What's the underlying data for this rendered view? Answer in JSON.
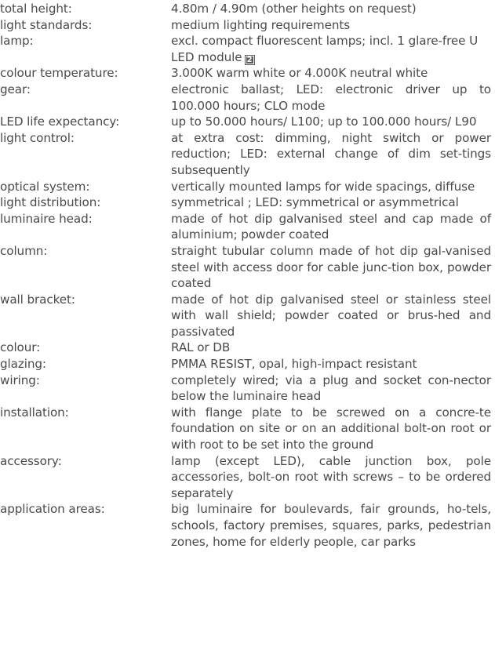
{
  "specs": [
    {
      "label": "total height:",
      "value": "4.80m / 4.90m (other heights on request)"
    },
    {
      "label": "light standards:",
      "value": "medium lighting requirements"
    },
    {
      "label": "lamp:",
      "value": "excl. compact fluorescent lamps; incl. 1 glare-free U LED module",
      "badge": "2"
    },
    {
      "label": "colour temperature:",
      "value": "3.000K warm white or 4.000K neutral white"
    },
    {
      "label": "gear:",
      "value": "electronic ballast; LED: electronic driver up to 100.000 hours; CLO mode"
    },
    {
      "label": "LED life expectancy:",
      "value": "up to 50.000 hours/ L100; up to 100.000 hours/ L90"
    },
    {
      "label": "light control:",
      "value": "at extra cost: dimming, night switch or power reduction; LED: external change of dim set-tings subsequently"
    },
    {
      "label": "optical system:",
      "value": "vertically mounted lamps for wide spacings, diffuse"
    },
    {
      "label": "light distribution:",
      "value": "symmetrical ; LED: symmetrical or asymmetrical"
    },
    {
      "label": "luminaire head:",
      "value": "made of hot dip galvanised steel and cap made of aluminium; powder coated"
    },
    {
      "label": "column:",
      "value": "straight tubular column made of hot dip gal-vanised steel with access door for cable junc-tion box, powder coated"
    },
    {
      "label": "wall bracket:",
      "value": "made of hot dip galvanised steel or stainless steel with wall shield; powder coated or brus-hed and passivated"
    },
    {
      "label": "colour:",
      "value": "RAL or DB"
    },
    {
      "label": "glazing:",
      "value": "PMMA RESIST, opal, high-impact resistant"
    },
    {
      "label": "wiring:",
      "value": "completely wired; via a plug and socket con-nector below the luminaire head"
    },
    {
      "label": "installation:",
      "value": "with flange plate to be screwed on a concre-te foundation on site or on an additional bolt-on root or with root to be set into the ground"
    },
    {
      "label": "accessory:",
      "value": "lamp (except LED), cable junction box, pole accessories, bolt-on root with screws – to be ordered separately"
    },
    {
      "label": "application areas:",
      "value": "big luminaire for boulevards, fair grounds, ho-tels, schools, factory premises, squares, parks, pedestrian zones, home for elderly people, car parks"
    }
  ]
}
